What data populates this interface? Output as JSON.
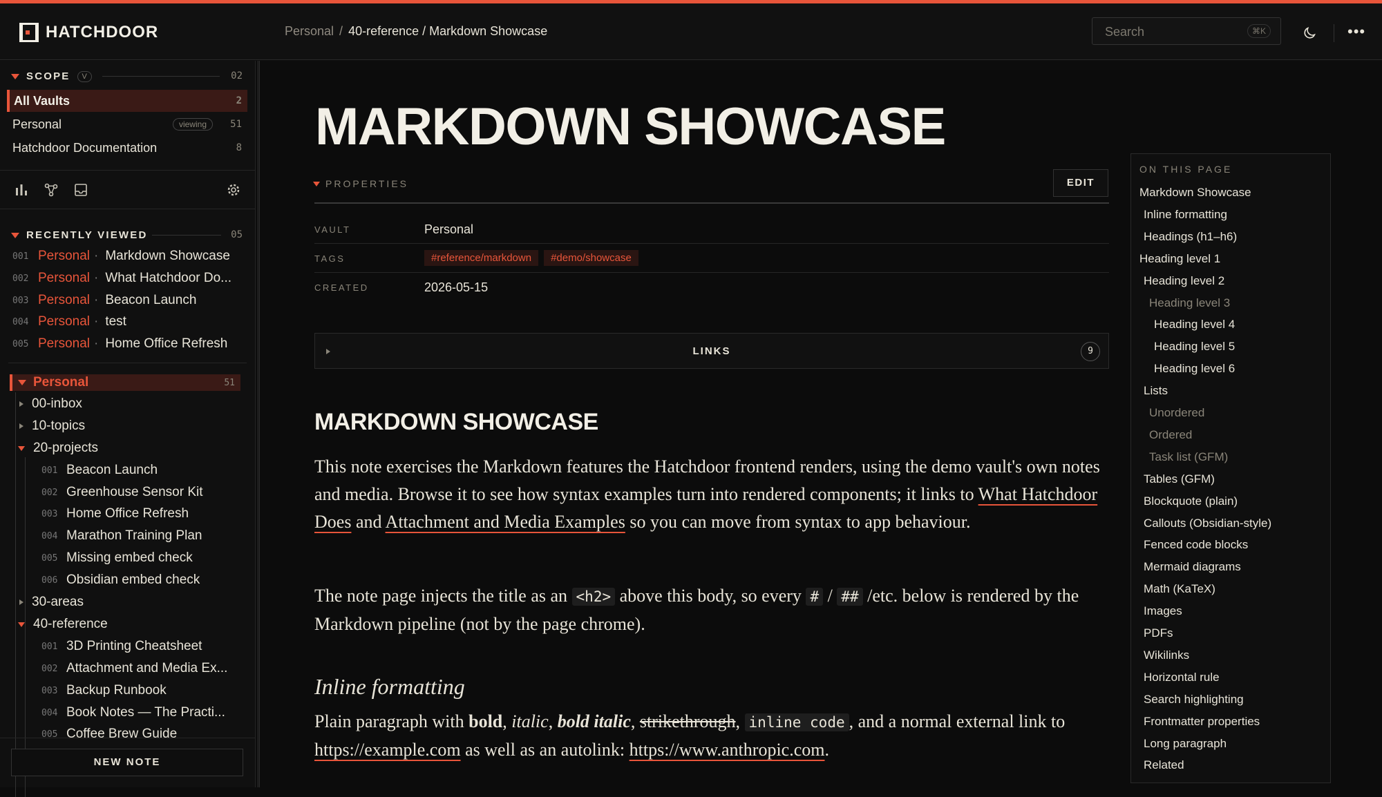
{
  "app": {
    "name": "HATCHDOOR",
    "accent": "#e8553a"
  },
  "breadcrumb": {
    "root": "Personal",
    "separator": "/",
    "current": "40-reference / Markdown Showcase"
  },
  "search": {
    "placeholder": "Search",
    "shortcut": "⌘K"
  },
  "sidebar": {
    "scope": {
      "title": "SCOPE",
      "badge": "V",
      "count": "02",
      "vaults": [
        {
          "label": "All Vaults",
          "count": "2"
        },
        {
          "label": "Personal",
          "tag": "viewing",
          "count": "51"
        },
        {
          "label": "Hatchdoor Documentation",
          "count": "8"
        }
      ]
    },
    "tools": [
      "bar-chart-icon",
      "graph-icon",
      "inbox-icon",
      "gear-icon"
    ],
    "recent": {
      "title": "RECENTLY VIEWED",
      "count": "05",
      "items": [
        {
          "num": "001",
          "vault": "Personal",
          "title": "Markdown Showcase"
        },
        {
          "num": "002",
          "vault": "Personal",
          "title": "What Hatchdoor Do..."
        },
        {
          "num": "003",
          "vault": "Personal",
          "title": "Beacon Launch"
        },
        {
          "num": "004",
          "vault": "Personal",
          "title": "test"
        },
        {
          "num": "005",
          "vault": "Personal",
          "title": "Home Office Refresh"
        }
      ]
    },
    "tree": {
      "root": "Personal",
      "root_count": "51",
      "folders": [
        "00-inbox",
        "10-topics",
        "20-projects",
        "30-areas",
        "40-reference"
      ],
      "projects": [
        {
          "num": "001",
          "label": "Beacon Launch"
        },
        {
          "num": "002",
          "label": "Greenhouse Sensor Kit"
        },
        {
          "num": "003",
          "label": "Home Office Refresh"
        },
        {
          "num": "004",
          "label": "Marathon Training Plan"
        },
        {
          "num": "005",
          "label": "Missing embed check"
        },
        {
          "num": "006",
          "label": "Obsidian embed check"
        }
      ],
      "reference": [
        {
          "num": "001",
          "label": "3D Printing Cheatsheet"
        },
        {
          "num": "002",
          "label": "Attachment and Media Ex..."
        },
        {
          "num": "003",
          "label": "Backup Runbook"
        },
        {
          "num": "004",
          "label": "Book Notes — The Practi..."
        },
        {
          "num": "005",
          "label": "Coffee Brew Guide"
        }
      ]
    },
    "new_note": "NEW NOTE"
  },
  "main": {
    "title": "MARKDOWN SHOWCASE",
    "properties_label": "PROPERTIES",
    "edit": "EDIT",
    "properties": {
      "vault_label": "VAULT",
      "vault": "Personal",
      "tags_label": "TAGS",
      "tags": [
        "#reference/markdown",
        "#demo/showcase"
      ],
      "created_label": "CREATED",
      "created": "2026-05-15"
    },
    "links": {
      "label": "LINKS",
      "count": "9"
    },
    "h2": "MARKDOWN SHOWCASE",
    "p1": {
      "a": "This note exercises the Markdown features the Hatchdoor frontend renders, using the demo vault's own notes and media. Browse it to see how syntax examples turn into rendered components; it links to ",
      "link1": "What Hatchdoor Does",
      "b": " and ",
      "link2": "Attachment and Media Examples",
      "c": " so you can move from syntax to app behaviour."
    },
    "p2": {
      "a": "The note page injects the title as an ",
      "code1": "<h2>",
      "b": " above this body, so every ",
      "code2": "#",
      "sep": " / ",
      "code3": "##",
      "c": " /etc. below is rendered by the Markdown pipeline (not by the page chrome)."
    },
    "h3": "Inline formatting",
    "p3": {
      "a": "Plain paragraph with ",
      "bold": "bold",
      "comma1": ", ",
      "italic": "italic",
      "comma2": ", ",
      "bolditalic": "bold italic",
      "comma3": ", ",
      "strike": "strikethrough",
      "comma4": ", ",
      "code": "inline code",
      "b": ", and a normal external link to ",
      "link1": "https://example.com",
      "c": " as well as an autolink: ",
      "link2": "https://www.anthropic.com",
      "d": "."
    }
  },
  "toc": {
    "title": "ON THIS PAGE",
    "items": [
      {
        "label": "Markdown Showcase",
        "level": 0
      },
      {
        "label": "Inline formatting",
        "level": 1
      },
      {
        "label": "Headings (h1–h6)",
        "level": 1
      },
      {
        "label": "Heading level 1",
        "level": 0
      },
      {
        "label": "Heading level 2",
        "level": 1
      },
      {
        "label": "Heading level 3",
        "level": 2,
        "dim": true
      },
      {
        "label": "Heading level 4",
        "level": 3
      },
      {
        "label": "Heading level 5",
        "level": 3
      },
      {
        "label": "Heading level 6",
        "level": 3
      },
      {
        "label": "Lists",
        "level": 1
      },
      {
        "label": "Unordered",
        "level": 2,
        "dim": true
      },
      {
        "label": "Ordered",
        "level": 2,
        "dim": true
      },
      {
        "label": "Task list (GFM)",
        "level": 2,
        "dim": true
      },
      {
        "label": "Tables (GFM)",
        "level": 1
      },
      {
        "label": "Blockquote (plain)",
        "level": 1
      },
      {
        "label": "Callouts (Obsidian-style)",
        "level": 1
      },
      {
        "label": "Fenced code blocks",
        "level": 1
      },
      {
        "label": "Mermaid diagrams",
        "level": 1
      },
      {
        "label": "Math (KaTeX)",
        "level": 1
      },
      {
        "label": "Images",
        "level": 1
      },
      {
        "label": "PDFs",
        "level": 1
      },
      {
        "label": "Wikilinks",
        "level": 1
      },
      {
        "label": "Horizontal rule",
        "level": 1
      },
      {
        "label": "Search highlighting",
        "level": 1
      },
      {
        "label": "Frontmatter properties",
        "level": 1
      },
      {
        "label": "Long paragraph",
        "level": 1
      },
      {
        "label": "Related",
        "level": 1
      }
    ]
  }
}
